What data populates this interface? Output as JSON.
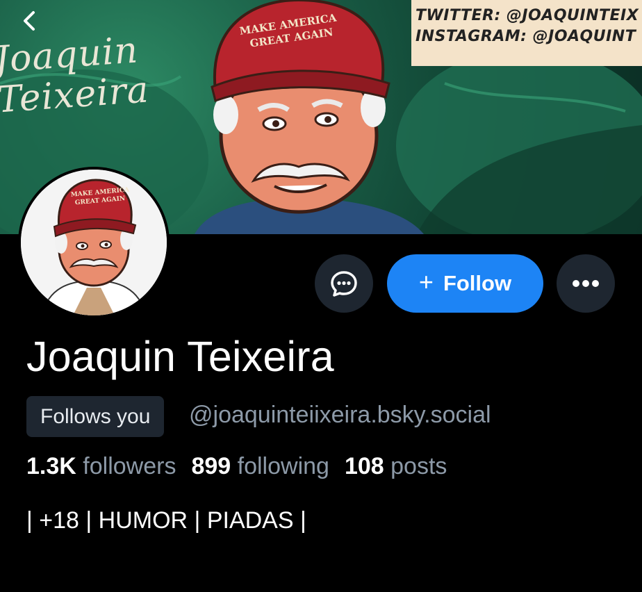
{
  "banner": {
    "script_text": "Joaquin\nTeixeira",
    "cap_text": "MAKE AMERICA GREAT AGAIN",
    "social_card": {
      "line1": "TWITTER: @JOAQUINTEIX",
      "line2": "INSTAGRAM: @JOAQUINT"
    }
  },
  "avatar": {
    "cap_text": "MAKE AMERICA GREAT AGAIN"
  },
  "actions": {
    "follow_plus": "+",
    "follow_label": "Follow"
  },
  "profile": {
    "display_name": "Joaquin Teixeira",
    "follows_badge": "Follows you",
    "handle": "@joaquinteiixeira.bsky.social",
    "stats": {
      "followers_count": "1.3K",
      "followers_label": "followers",
      "following_count": "899",
      "following_label": "following",
      "posts_count": "108",
      "posts_label": "posts"
    },
    "bio": "| +18 | HUMOR | PIADAS |"
  },
  "icons": {
    "back": "chevron-left-icon",
    "message": "chat-bubble-icon",
    "more": "ellipsis-icon"
  },
  "colors": {
    "background": "#000000",
    "follow_button": "#1d84f5",
    "secondary_button": "#1e2630",
    "muted_text": "#8d9aa8"
  }
}
